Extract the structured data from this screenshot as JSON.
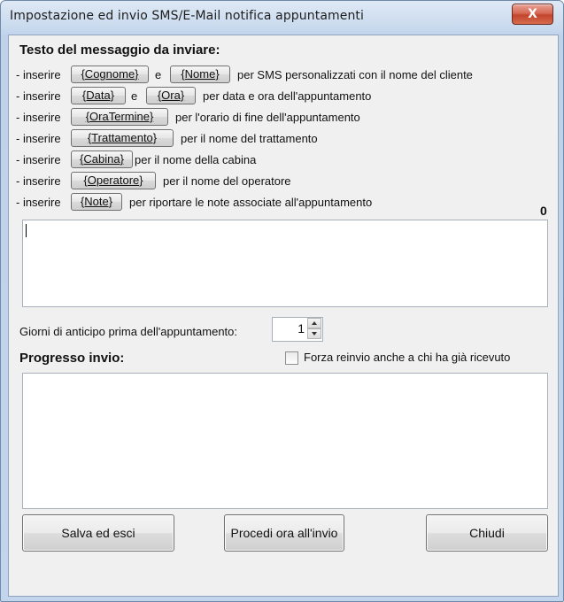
{
  "window": {
    "title": "Impostazione ed invio SMS/E-Mail notifica appuntamenti",
    "close_label": "X"
  },
  "message_section": {
    "heading": "Testo del messaggio da inviare:",
    "hints": [
      {
        "prefix": "- inserire",
        "chips": [
          "{Cognome}",
          "{Nome}"
        ],
        "separator": "e",
        "text": "per SMS personalizzati con il nome del cliente"
      },
      {
        "prefix": "- inserire",
        "chips": [
          "{Data}",
          "{Ora}"
        ],
        "separator": "e",
        "text": "per data e ora dell'appuntamento"
      },
      {
        "prefix": "- inserire",
        "chips": [
          "{OraTermine}"
        ],
        "text": "per l'orario di fine dell'appuntamento"
      },
      {
        "prefix": "- inserire",
        "chips": [
          "{Trattamento}"
        ],
        "text": "per il nome del trattamento"
      },
      {
        "prefix": "- inserire",
        "chips": [
          "{Cabina}"
        ],
        "text": "per il nome della cabina"
      },
      {
        "prefix": "- inserire",
        "chips": [
          "{Operatore}"
        ],
        "text": "per il nome del operatore"
      },
      {
        "prefix": "- inserire",
        "chips": [
          "{Note}"
        ],
        "text": "per riportare le note associate all'appuntamento"
      }
    ],
    "char_count": "0",
    "message_value": ""
  },
  "days": {
    "label": "Giorni di anticipo prima dell'appuntamento:",
    "value": "1"
  },
  "progress": {
    "heading": "Progresso invio:",
    "force_resend_label": "Forza reinvio anche a chi ha già ricevuto",
    "force_resend_checked": false,
    "log_value": ""
  },
  "buttons": {
    "save_exit": "Salva ed esci",
    "send_now": "Procedi ora all'invio",
    "close": "Chiudi"
  },
  "colors": {
    "titlebar": "#c3d5ec",
    "client_bg": "#f0f0f0",
    "close_button": "#c2452d"
  }
}
